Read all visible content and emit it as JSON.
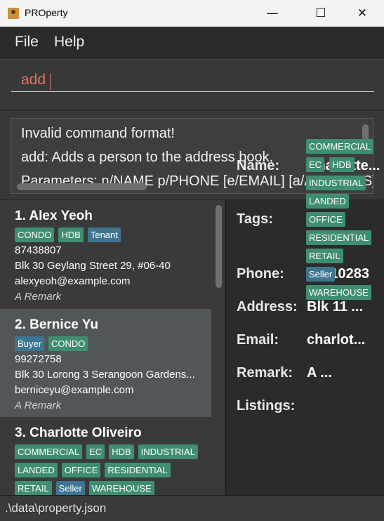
{
  "window": {
    "title": "PROperty"
  },
  "menu": {
    "file": "File",
    "help": "Help"
  },
  "command": {
    "value": "add"
  },
  "result": {
    "lines": [
      "Invalid command format!",
      "add: Adds a person to the address book.",
      "Parameters: n/NAME p/PHONE [e/EMAIL] [a/ADDRESS]"
    ]
  },
  "persons": [
    {
      "index_name": "1. Alex Yeoh",
      "tags": [
        {
          "label": "CONDO",
          "color": "#3f8e70"
        },
        {
          "label": "HDB",
          "color": "#3f8e70"
        },
        {
          "label": "Tenant",
          "color": "#3e7591"
        }
      ],
      "phone": "87438807",
      "address": "Blk 30 Geylang Street 29, #06-40",
      "email": "alexyeoh@example.com",
      "remark": "A Remark"
    },
    {
      "index_name": "2. Bernice Yu",
      "tags": [
        {
          "label": "Buyer",
          "color": "#3e7591"
        },
        {
          "label": "CONDO",
          "color": "#3f8e70"
        }
      ],
      "phone": "99272758",
      "address": "Blk 30 Lorong 3 Serangoon Gardens...",
      "email": "berniceyu@example.com",
      "remark": "A Remark"
    },
    {
      "index_name": "3. Charlotte Oliveiro",
      "tags_row1": [
        "COMMERCIAL",
        "EC",
        "HDB",
        "INDUSTRIAL"
      ],
      "tags_row2": [
        "LANDED",
        "OFFICE",
        "RESIDENTIAL"
      ],
      "tags_row3": [
        {
          "label": "RETAIL",
          "color": "#3f8e70"
        },
        {
          "label": "Seller",
          "color": "#3e7591"
        },
        {
          "label": "WAREHOUSE",
          "color": "#3f8e70"
        }
      ]
    }
  ],
  "details": {
    "labels": {
      "name": "Name:",
      "tags": "Tags:",
      "phone": "Phone:",
      "address": "Address:",
      "email": "Email:",
      "remark": "Remark:",
      "listings": "Listings:"
    },
    "name": "Charlotte...",
    "phone": "93210283",
    "address": "Blk 11 ...",
    "email": "charlot...",
    "remark": "A ...",
    "tag_rows": [
      [
        "COMMERCIAL"
      ],
      [
        "EC",
        "HDB"
      ],
      [
        "INDUSTRIAL"
      ],
      [
        "LANDED"
      ],
      [
        "OFFICE"
      ],
      [
        "RESIDENTIAL"
      ],
      [
        "RETAIL"
      ],
      [
        "Seller"
      ],
      [
        "WAREHOUSE"
      ]
    ]
  },
  "status": {
    "path": ".\\data\\property.json"
  }
}
